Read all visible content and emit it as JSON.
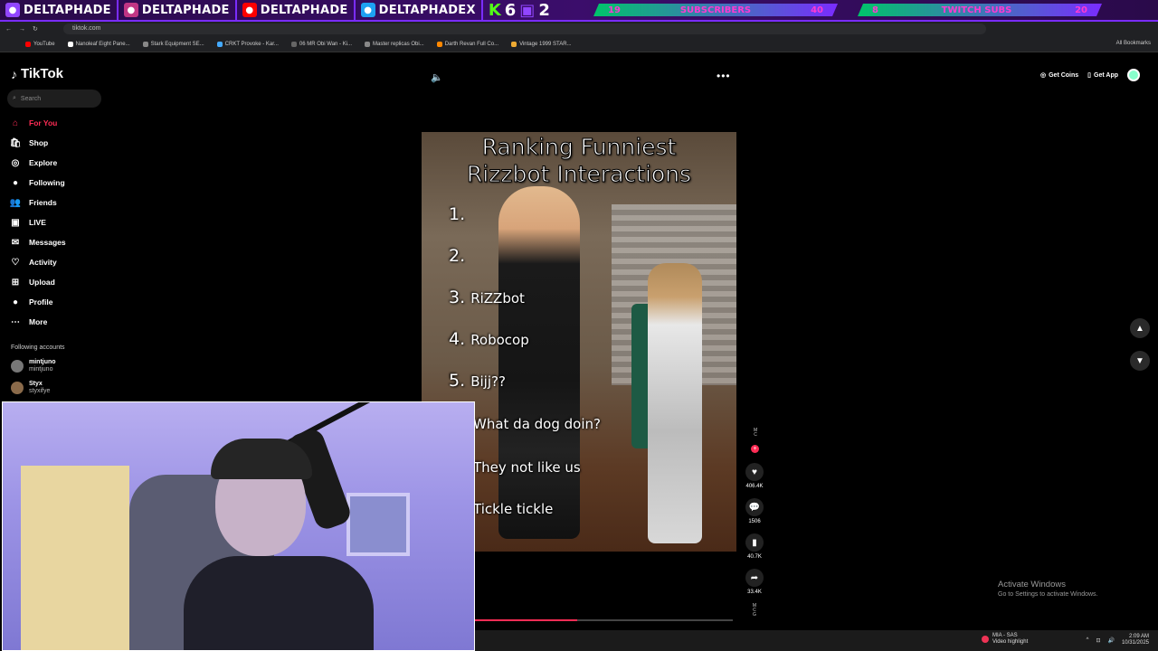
{
  "overlay": {
    "socials": [
      {
        "icon": "twitch-icon",
        "handle": "DELTAPHADE",
        "color": "#9146ff"
      },
      {
        "icon": "instagram-icon",
        "handle": "DELTAPHADE",
        "color": "#c13584"
      },
      {
        "icon": "youtube-icon",
        "handle": "DELTAPHADE",
        "color": "#ff0000"
      },
      {
        "icon": "twitter-icon",
        "handle": "DELTAPHADEX",
        "color": "#1da1f2"
      }
    ],
    "kick_count": "6",
    "twitch_count": "2",
    "subs_current": "19",
    "subs_label": "SUBSCRIBERS",
    "subs_goal": "40",
    "twitch_subs_current": "8",
    "twitch_subs_label": "TWITCH SUBS",
    "twitch_subs_goal": "20"
  },
  "browser": {
    "url": "tiktok.com",
    "bookmarks": [
      "YouTube",
      "Nanoleaf Eight Pane...",
      "Stark Equipment SE...",
      "CRKT Provoke - Kar...",
      "06 MR Obi Wan - Ki...",
      "Master replicas Obi...",
      "Darth Revan Full Co...",
      "Vintage 1999 STAR..."
    ],
    "all_bookmarks": "All Bookmarks"
  },
  "tiktok": {
    "logo": "TikTok",
    "search_placeholder": "Search",
    "nav": [
      {
        "label": "For You",
        "icon": "home-icon",
        "glyph": "⌂",
        "active": true
      },
      {
        "label": "Shop",
        "icon": "shop-icon",
        "glyph": "🛍",
        "active": false
      },
      {
        "label": "Explore",
        "icon": "compass-icon",
        "glyph": "◎",
        "active": false
      },
      {
        "label": "Following",
        "icon": "following-icon",
        "glyph": "●",
        "active": false
      },
      {
        "label": "Friends",
        "icon": "friends-icon",
        "glyph": "👥",
        "active": false
      },
      {
        "label": "LIVE",
        "icon": "live-icon",
        "glyph": "▣",
        "active": false
      },
      {
        "label": "Messages",
        "icon": "messages-icon",
        "glyph": "✉",
        "active": false
      },
      {
        "label": "Activity",
        "icon": "activity-icon",
        "glyph": "♡",
        "active": false
      },
      {
        "label": "Upload",
        "icon": "upload-icon",
        "glyph": "⊞",
        "active": false
      },
      {
        "label": "Profile",
        "icon": "profile-icon",
        "glyph": "●",
        "active": false
      },
      {
        "label": "More",
        "icon": "more-icon",
        "glyph": "⋯",
        "active": false
      }
    ],
    "following_title": "Following accounts",
    "accounts": [
      {
        "name": "mintjuno",
        "handle": "mintjuno"
      },
      {
        "name": "Styx",
        "handle": "styxifye"
      }
    ],
    "top_right": {
      "coins": "Get Coins",
      "app": "Get App"
    },
    "video": {
      "title_line1": "Ranking Funniest",
      "title_line2": "Rizzbot Interactions",
      "ranks": [
        {
          "num": "1.",
          "label": ""
        },
        {
          "num": "2.",
          "label": ""
        },
        {
          "num": "3.",
          "label": "RiZZbot"
        },
        {
          "num": "4.",
          "label": "Robocop"
        },
        {
          "num": "5.",
          "label": "Bijj??"
        }
      ],
      "captions": [
        "What da dog doin?",
        "They not like us",
        "Tickle tickle"
      ],
      "progress": 0.5
    },
    "actions": {
      "likes": "406.4K",
      "comments": "1506",
      "saves": "40.7K",
      "shares": "33.4K"
    }
  },
  "windows": {
    "activate_title": "Activate Windows",
    "activate_sub": "Go to Settings to activate Windows.",
    "taskbar_app": "MIA - SAS",
    "taskbar_app_sub": "Video highlight",
    "time": "2:09 AM",
    "date": "10/31/2025"
  }
}
